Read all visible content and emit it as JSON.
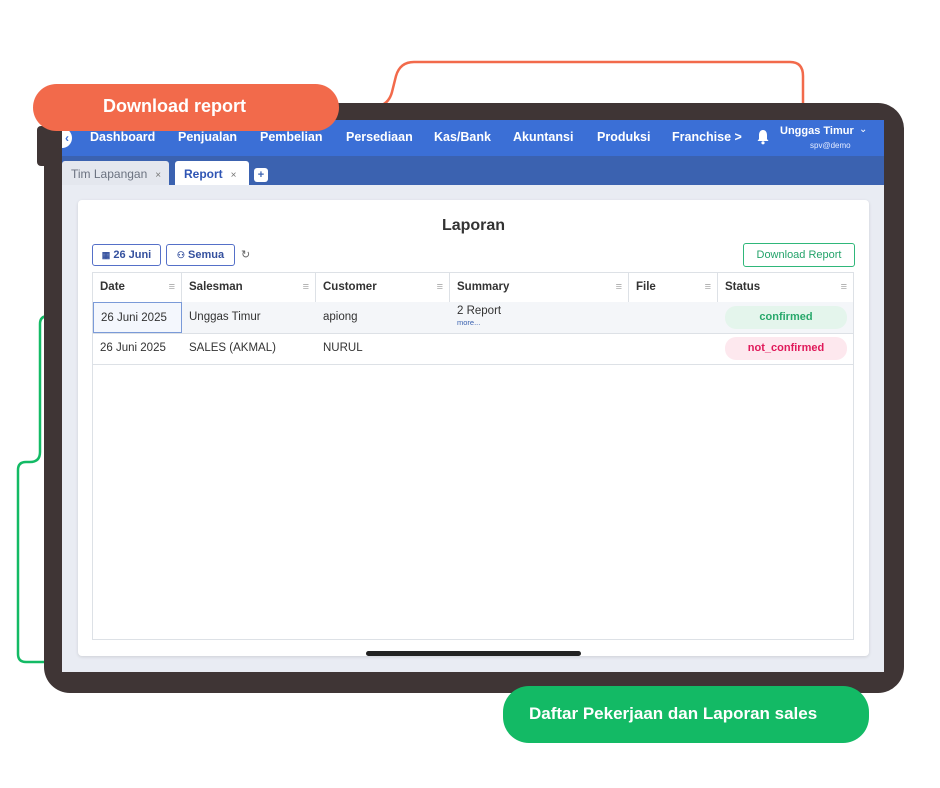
{
  "callouts": {
    "download": "Download report",
    "daftar": "Daftar Pekerjaan dan Laporan sales"
  },
  "colors": {
    "nav": "#3b6fd6",
    "tabbar": "#3b62b0",
    "accent_orange": "#f26a4b",
    "accent_green": "#13ba65",
    "confirmed": "#28a86b",
    "not_confirmed": "#e0195a"
  },
  "nav": {
    "items": [
      "Dashboard",
      "Penjualan",
      "Pembelian",
      "Persediaan",
      "Kas/Bank",
      "Akuntansi",
      "Produksi",
      "Franchise >"
    ],
    "bell_icon": "bell-icon",
    "user_name": "Unggas Timur",
    "user_sub": "spv@demo"
  },
  "tabs": {
    "inactive": "Tim Lapangan",
    "active": "Report",
    "close": "×",
    "add": "+"
  },
  "page": {
    "title": "Laporan",
    "date_filter": "26 Juni",
    "user_filter": "Semua",
    "download_button": "Download Report"
  },
  "table": {
    "columns": [
      "Date",
      "Salesman",
      "Customer",
      "Summary",
      "File",
      "Status"
    ],
    "rows": [
      {
        "date": "26 Juni 2025",
        "salesman": "Unggas Timur",
        "customer": "apiong",
        "summary": "2 Report",
        "summary_more": "more...",
        "file": "",
        "status": "confirmed"
      },
      {
        "date": "26 Juni 2025",
        "salesman": "SALES (AKMAL)",
        "customer": "NURUL",
        "summary": "",
        "summary_more": "",
        "file": "",
        "status": "not_confirmed"
      }
    ]
  }
}
